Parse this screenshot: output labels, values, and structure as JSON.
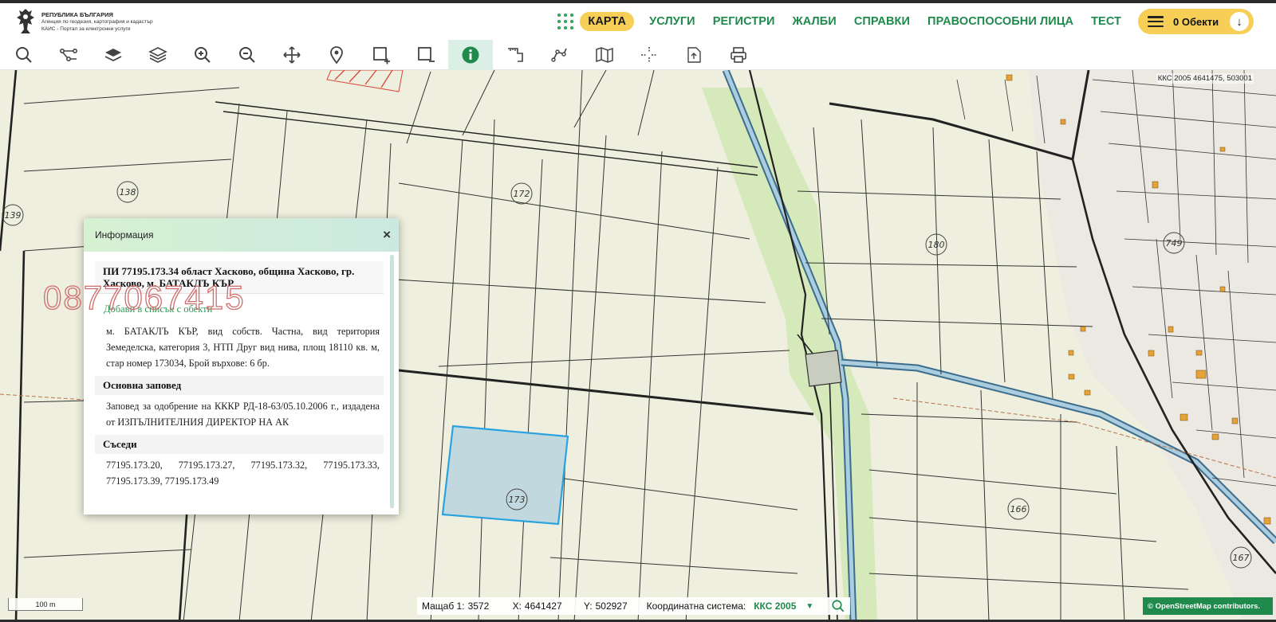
{
  "header": {
    "logo": {
      "line1": "РЕПУБЛИКА БЪЛГАРИЯ",
      "line2": "Агенция по геодезия, картография и кадастър",
      "line3": "КАИС - Портал за електронни услуги"
    },
    "nav": [
      "КАРТА",
      "УСЛУГИ",
      "РЕГИСТРИ",
      "ЖАЛБИ",
      "СПРАВКИ",
      "ПРАВОСПОСОБНИ ЛИЦА",
      "ТЕСТ"
    ],
    "active_nav": "КАРТА",
    "objects_label": "0 Обекти"
  },
  "toolbar": {
    "tools": [
      "search-icon",
      "route-icon",
      "layers-filled-icon",
      "layers-icon",
      "zoom-in-icon",
      "zoom-out-icon",
      "pan-icon",
      "location-pin-icon",
      "select-add-icon",
      "select-remove-icon",
      "info-icon",
      "measure-icon",
      "polyline-icon",
      "map-icon",
      "crosshair-icon",
      "export-icon",
      "print-icon"
    ],
    "active_tool": "info-icon"
  },
  "map": {
    "coord_readout": "ККС 2005 4641475, 503001",
    "parcel_labels": [
      "138",
      "139",
      "172",
      "173",
      "180",
      "749",
      "166",
      "167"
    ],
    "scale_bar": "100 m",
    "attribution": "© OpenStreetMap contributors."
  },
  "watermark": "0877067415",
  "info_panel": {
    "title": "Информация",
    "close": "×",
    "parcel_title": "ПИ 77195.173.34 област Хасково, община Хасково, гр. Хасково, м. БАТАКЛЪ КЪР",
    "add_link": "Добави в списък с обекти",
    "description": "м. БАТАКЛЪ КЪР, вид собств. Частна, вид територия Земеделска, категория 3, НТП Друг вид нива, площ 18110 кв. м, стар номер 173034, Брой върхове: 6 бр.",
    "order_title": "Основна заповед",
    "order_text": "Заповед за одобрение на КККР РД-18-63/05.10.2006 г., издадена от ИЗПЪЛНИТЕЛНИЯ ДИРЕКТОР НА АК",
    "neighbors_title": "Съседи",
    "neighbors_text": "77195.173.20, 77195.173.27, 77195.173.32, 77195.173.33, 77195.173.39, 77195.173.49"
  },
  "statusbar": {
    "scale_label": "Мащаб 1:",
    "scale_value": "3572",
    "x_label": "X:",
    "x_value": "4641427",
    "y_label": "Y:",
    "y_value": "502927",
    "crs_label": "Координатна система:",
    "crs_value": "ККС 2005"
  },
  "colors": {
    "accent_green": "#1f8a4c",
    "accent_yellow": "#f7cf57",
    "map_background": "#efefdf",
    "selected_parcel": "#c2d8df",
    "selected_border": "#29a3df"
  }
}
